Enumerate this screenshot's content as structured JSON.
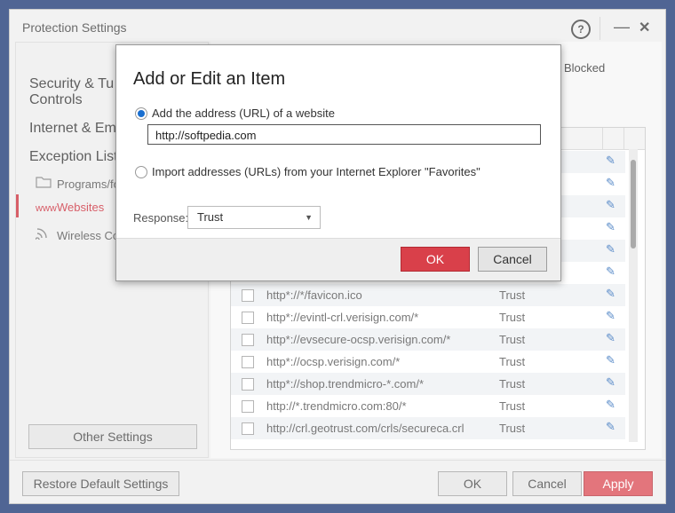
{
  "window": {
    "title": "Protection Settings",
    "help": "?",
    "minimize": "—",
    "close": "✕"
  },
  "sidebar": {
    "security": "Security & Tu",
    "security2": "Controls",
    "internet": "Internet & Em",
    "exception": "Exception Lists",
    "programs": "Programs/fo",
    "websites": "Websites",
    "wireless": "Wireless Co",
    "websites_icon_text": "www",
    "other_settings": "Other Settings"
  },
  "main": {
    "blocked": "Blocked",
    "rows": [
      {
        "url": "",
        "response": ""
      },
      {
        "url": "",
        "response": ""
      },
      {
        "url": "",
        "response": ""
      },
      {
        "url": "",
        "response": ""
      },
      {
        "url": "",
        "response": ""
      },
      {
        "url": "",
        "response": ""
      },
      {
        "url": "http*://*/favicon.ico",
        "response": "Trust"
      },
      {
        "url": "http*://evintl-crl.verisign.com/*",
        "response": "Trust"
      },
      {
        "url": "http*://evsecure-ocsp.verisign.com/*",
        "response": "Trust"
      },
      {
        "url": "http*://ocsp.verisign.com/*",
        "response": "Trust"
      },
      {
        "url": "http*://shop.trendmicro-*.com/*",
        "response": "Trust"
      },
      {
        "url": "http://*.trendmicro.com:80/*",
        "response": "Trust"
      },
      {
        "url": "http://crl.geotrust.com/crls/secureca.crl",
        "response": "Trust"
      }
    ]
  },
  "footer": {
    "restore": "Restore Default Settings",
    "ok": "OK",
    "cancel": "Cancel",
    "apply": "Apply"
  },
  "dialog": {
    "title": "Add or Edit an Item",
    "option_url": "Add the address (URL) of a website",
    "url_value": "http://softpedia.com",
    "option_import": "Import addresses (URLs) from your Internet Explorer \"Favorites\"",
    "response_label": "Response:",
    "response_value": "Trust",
    "ok": "OK",
    "cancel": "Cancel"
  },
  "colors": {
    "accent_red": "#d9404a",
    "radio_blue": "#1a6fd0",
    "backdrop": "#0d2a6b"
  },
  "icons": [
    "help-icon",
    "minimize-icon",
    "close-icon",
    "folder-icon",
    "www-icon",
    "wireless-icon",
    "pencil-icon",
    "chevron-down-icon"
  ]
}
